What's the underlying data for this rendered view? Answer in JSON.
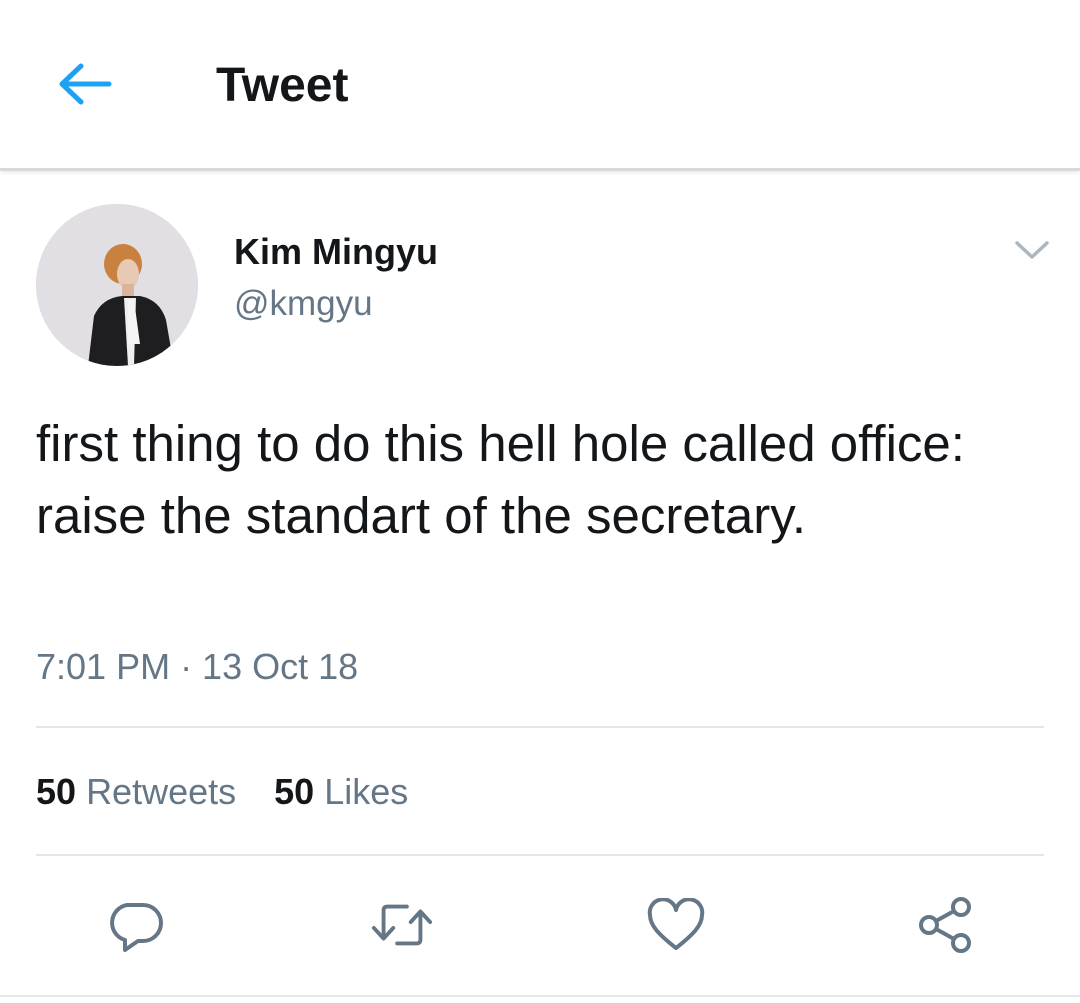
{
  "header": {
    "title": "Tweet",
    "back_icon": "arrow-left-icon"
  },
  "tweet": {
    "author": {
      "name": "Kim Mingyu",
      "handle": "@kmgyu"
    },
    "text": "first thing to do this hell hole called office: raise the standart of the secretary.",
    "timestamp": "7:01 PM · 13 Oct 18",
    "stats": {
      "retweets_count": "50",
      "retweets_label": "Retweets",
      "likes_count": "50",
      "likes_label": "Likes"
    },
    "actions": [
      "reply-icon",
      "retweet-icon",
      "like-icon",
      "share-icon"
    ]
  },
  "colors": {
    "accent": "#1da1f2",
    "text_primary": "#14171a",
    "text_secondary": "#657786",
    "icon_gray": "#657786",
    "divider": "#e1e8ed",
    "chevron": "#aab8c2"
  }
}
